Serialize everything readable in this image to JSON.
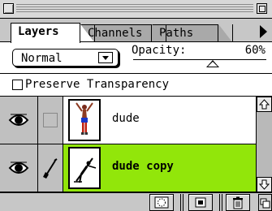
{
  "tabs": [
    {
      "label": "Layers"
    },
    {
      "label": "Channels"
    },
    {
      "label": "Paths"
    }
  ],
  "controls": {
    "blend_mode": "Normal",
    "opacity_label": "Opacity:",
    "opacity_value": "60%",
    "opacity_fraction": 0.6
  },
  "preserve": {
    "label": "Preserve Transparency",
    "checked": false
  },
  "layers": [
    {
      "name": "dude",
      "visible": true,
      "selected": false
    },
    {
      "name": "dude copy",
      "visible": true,
      "selected": true
    }
  ],
  "colors": {
    "selected_layer": "#92e60a",
    "panel": "#c7c7c7"
  },
  "icons": {
    "eye": "eye-icon",
    "brush": "paintbrush-icon",
    "mask": "layer-mask-icon",
    "new_layer": "new-layer-icon",
    "trash": "trash-icon"
  }
}
